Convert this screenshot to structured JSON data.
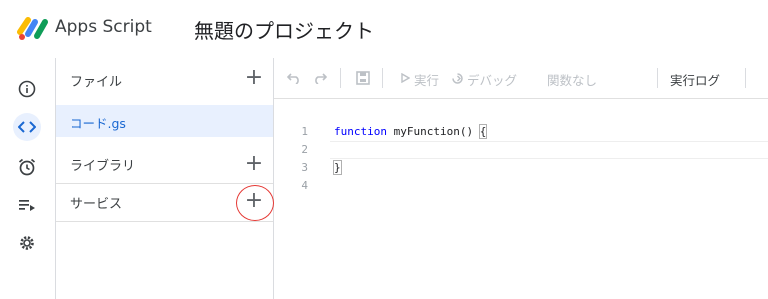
{
  "header": {
    "app_name": "Apps Script",
    "project_title": "無題のプロジェクト"
  },
  "rail": {
    "items": [
      {
        "name": "info-icon"
      },
      {
        "name": "code-icon",
        "active": true
      },
      {
        "name": "alarm-clock-icon"
      },
      {
        "name": "executions-icon"
      },
      {
        "name": "gear-icon"
      }
    ]
  },
  "files_panel": {
    "files_label": "ファイル",
    "files": [
      {
        "name": "コード.gs",
        "selected": true
      }
    ],
    "libraries_label": "ライブラリ",
    "services_label": "サービス",
    "add_symbol": "+"
  },
  "toolbar": {
    "run_label": "実行",
    "debug_label": "デバッグ",
    "function_select": "関数なし",
    "log_label": "実行ログ"
  },
  "editor": {
    "lines": [
      {
        "no": "1",
        "keyword": "function",
        "rest": " myFunction() ",
        "brace": "{"
      },
      {
        "no": "2",
        "keyword": "",
        "rest": "",
        "brace": ""
      },
      {
        "no": "3",
        "keyword": "",
        "rest": "",
        "brace": "}"
      },
      {
        "no": "4",
        "keyword": "",
        "rest": "",
        "brace": ""
      }
    ]
  },
  "colors": {
    "accent": "#1967d2",
    "active_bg": "#e8f0fe",
    "annotation": "#e53935",
    "keyword": "#0000ff"
  }
}
